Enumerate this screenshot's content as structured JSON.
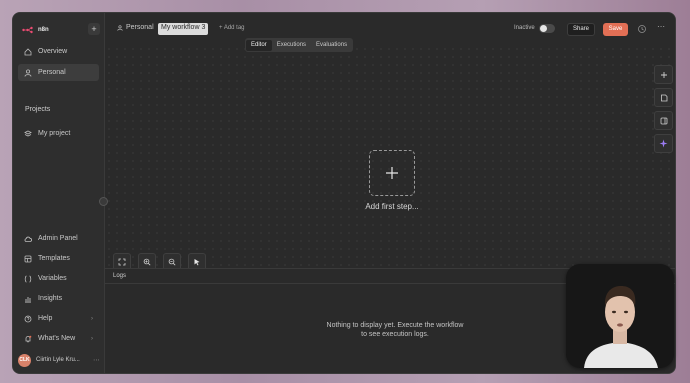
{
  "app": {
    "logo_text": "n8n",
    "brand_color": "#ea4b71",
    "accent_color": "#e26f55"
  },
  "sidebar": {
    "items": [
      {
        "label": "Overview",
        "icon": "home-icon"
      },
      {
        "label": "Personal",
        "icon": "user-icon",
        "active": true
      }
    ],
    "projects_label": "Projects",
    "projects": [
      {
        "label": "My project",
        "icon": "layers-icon"
      }
    ],
    "bottom_items": [
      {
        "label": "Admin Panel",
        "icon": "cloud-icon"
      },
      {
        "label": "Templates",
        "icon": "template-icon"
      },
      {
        "label": "Variables",
        "icon": "variables-icon"
      },
      {
        "label": "Insights",
        "icon": "chart-icon"
      },
      {
        "label": "Help",
        "icon": "help-icon"
      },
      {
        "label": "What's New",
        "icon": "bell-icon"
      }
    ],
    "user": {
      "initials": "CLK",
      "name": "Ciirtin Lyle Kru..."
    }
  },
  "header": {
    "breadcrumb": "Personal",
    "workflow_name": "My workflow 3",
    "add_tag": "+ Add tag",
    "status_label": "Inactive",
    "share_label": "Share",
    "save_label": "Save",
    "tabs": [
      {
        "label": "Editor",
        "active": true
      },
      {
        "label": "Executions"
      },
      {
        "label": "Evaluations"
      }
    ]
  },
  "canvas": {
    "add_step_label": "Add first step..."
  },
  "logs": {
    "title": "Logs",
    "empty_message": "Nothing to display yet. Execute the workflow to see execution logs."
  }
}
